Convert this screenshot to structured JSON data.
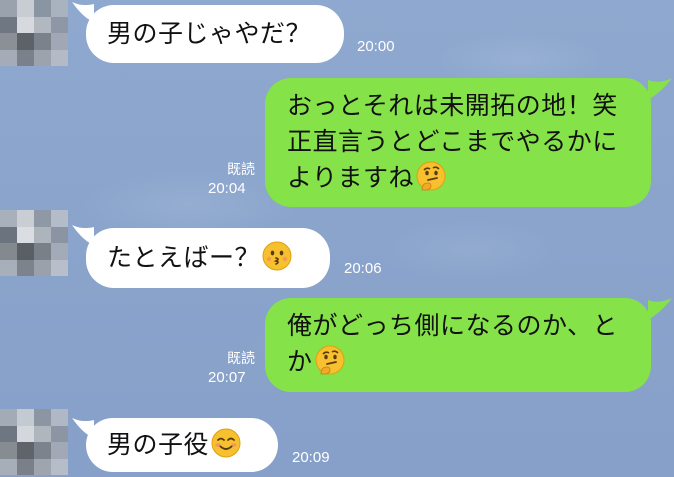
{
  "messages": [
    {
      "id": "m1",
      "direction": "incoming",
      "text": "男の子じゃやだ？",
      "time": "20:00"
    },
    {
      "id": "m2",
      "direction": "outgoing",
      "lines": [
        "おっとそれは未開拓の地！笑",
        "正直言うとどこまでやるかに",
        "よりますね"
      ],
      "emoji": "thinking-face-icon",
      "read_label": "既読",
      "time": "20:04"
    },
    {
      "id": "m3",
      "direction": "incoming",
      "text": "たとえばー？",
      "emoji": "kissing-face-icon",
      "time": "20:06"
    },
    {
      "id": "m4",
      "direction": "outgoing",
      "lines": [
        "俺がどっち側になるのか、と",
        "か"
      ],
      "emoji": "thinking-face-icon",
      "read_label": "既読",
      "time": "20:07"
    },
    {
      "id": "m5",
      "direction": "incoming",
      "text": "男の子役",
      "emoji": "smiling-face-icon",
      "time": "20:09"
    }
  ],
  "colors": {
    "background": "#8aa4cc",
    "incoming_bubble": "#ffffff",
    "outgoing_bubble": "#85e249",
    "meta_text": "#ffffff"
  }
}
